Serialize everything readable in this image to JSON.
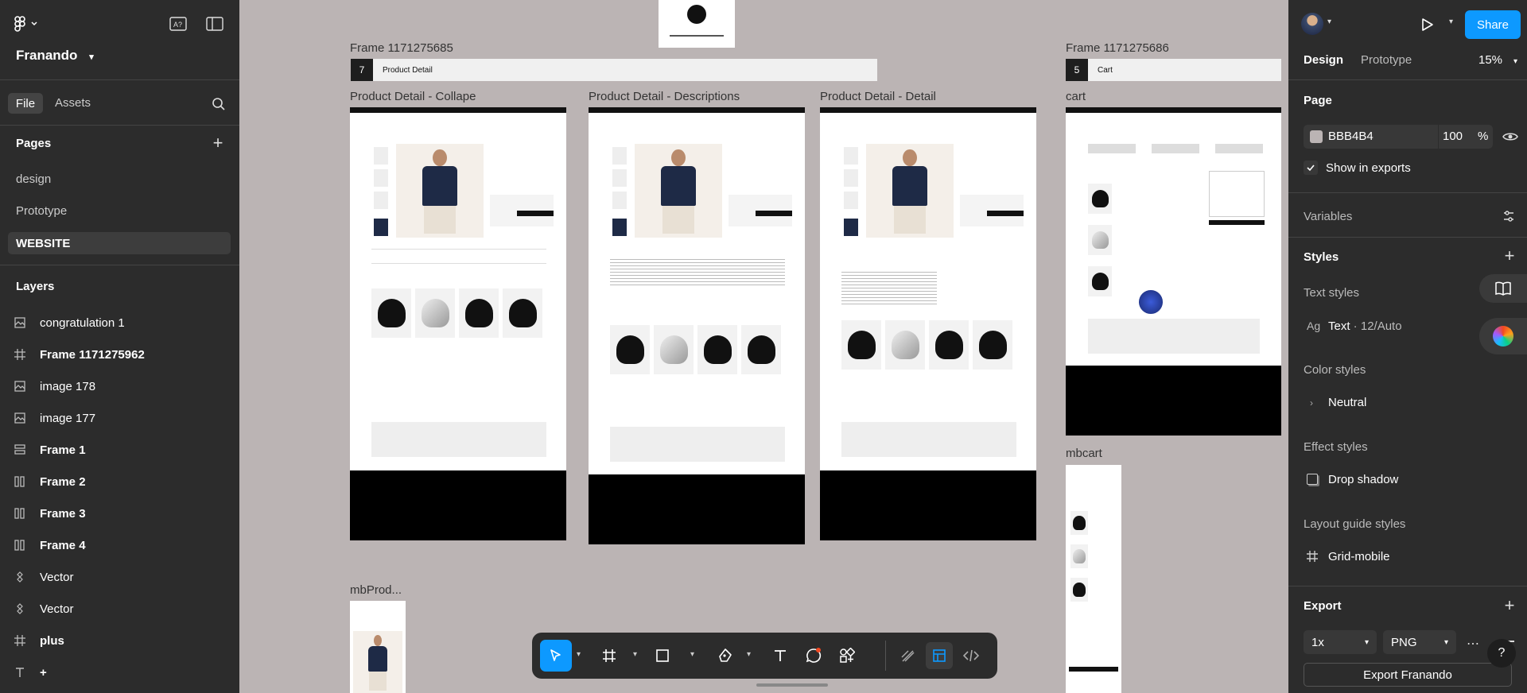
{
  "app": {
    "project_name": "Franando"
  },
  "left": {
    "tabs": {
      "file": "File",
      "assets": "Assets"
    },
    "pages_title": "Pages",
    "pages": [
      "design",
      "Prototype",
      "WEBSITE"
    ],
    "layers_title": "Layers",
    "layers": [
      {
        "label": "congratulation 1",
        "icon": "image-icon",
        "bold": false
      },
      {
        "label": "Frame 1171275962",
        "icon": "frame-icon",
        "bold": true
      },
      {
        "label": "image 178",
        "icon": "image-icon",
        "bold": false
      },
      {
        "label": "image 177",
        "icon": "image-icon",
        "bold": false
      },
      {
        "label": "Frame 1",
        "icon": "vertical-auto-layout-icon",
        "bold": true
      },
      {
        "label": "Frame 2",
        "icon": "horizontal-auto-layout-icon",
        "bold": true
      },
      {
        "label": "Frame 3",
        "icon": "horizontal-auto-layout-icon",
        "bold": true
      },
      {
        "label": "Frame 4",
        "icon": "horizontal-auto-layout-icon",
        "bold": true
      },
      {
        "label": "Vector",
        "icon": "component-icon",
        "bold": false
      },
      {
        "label": "Vector",
        "icon": "component-icon",
        "bold": false
      },
      {
        "label": "plus",
        "icon": "frame-icon",
        "bold": true
      },
      {
        "label": "+",
        "icon": "text-icon",
        "bold": true
      }
    ]
  },
  "canvas": {
    "frame_left": {
      "title": "Frame 1171275685",
      "number": "7",
      "label": "Product Detail"
    },
    "frame_right": {
      "title": "Frame 1171275686",
      "number": "5",
      "label": "Cart"
    },
    "frames": [
      {
        "title": "Product Detail - Collape"
      },
      {
        "title": "Product Detail - Descriptions"
      },
      {
        "title": "Product Detail - Detail"
      },
      {
        "title": "cart"
      },
      {
        "title": "mbcart"
      },
      {
        "title": "mbProd..."
      }
    ]
  },
  "right": {
    "tabs": {
      "design": "Design",
      "prototype": "Prototype"
    },
    "zoom": "15%",
    "share_label": "Share",
    "page_title": "Page",
    "page_color": "BBB4B4",
    "page_opacity": "100",
    "percent_symbol": "%",
    "show_in_exports": "Show in exports",
    "variables": "Variables",
    "styles": "Styles",
    "text_styles": "Text styles",
    "text_style_icon": "Ag",
    "text_style_name": "Text",
    "text_style_value": "12/Auto",
    "color_styles": "Color styles",
    "color_group": "Neutral",
    "effect_styles": "Effect styles",
    "effect_name": "Drop shadow",
    "layout_guide_styles": "Layout guide styles",
    "layout_guide_name": "Grid-mobile",
    "export_title": "Export",
    "export_scale": "1x",
    "export_format": "PNG",
    "export_button": "Export Franando",
    "help": "?"
  },
  "colors": {
    "panel": "#2c2c2c",
    "canvas": "#bbb4b4",
    "accent": "#0d99ff"
  }
}
